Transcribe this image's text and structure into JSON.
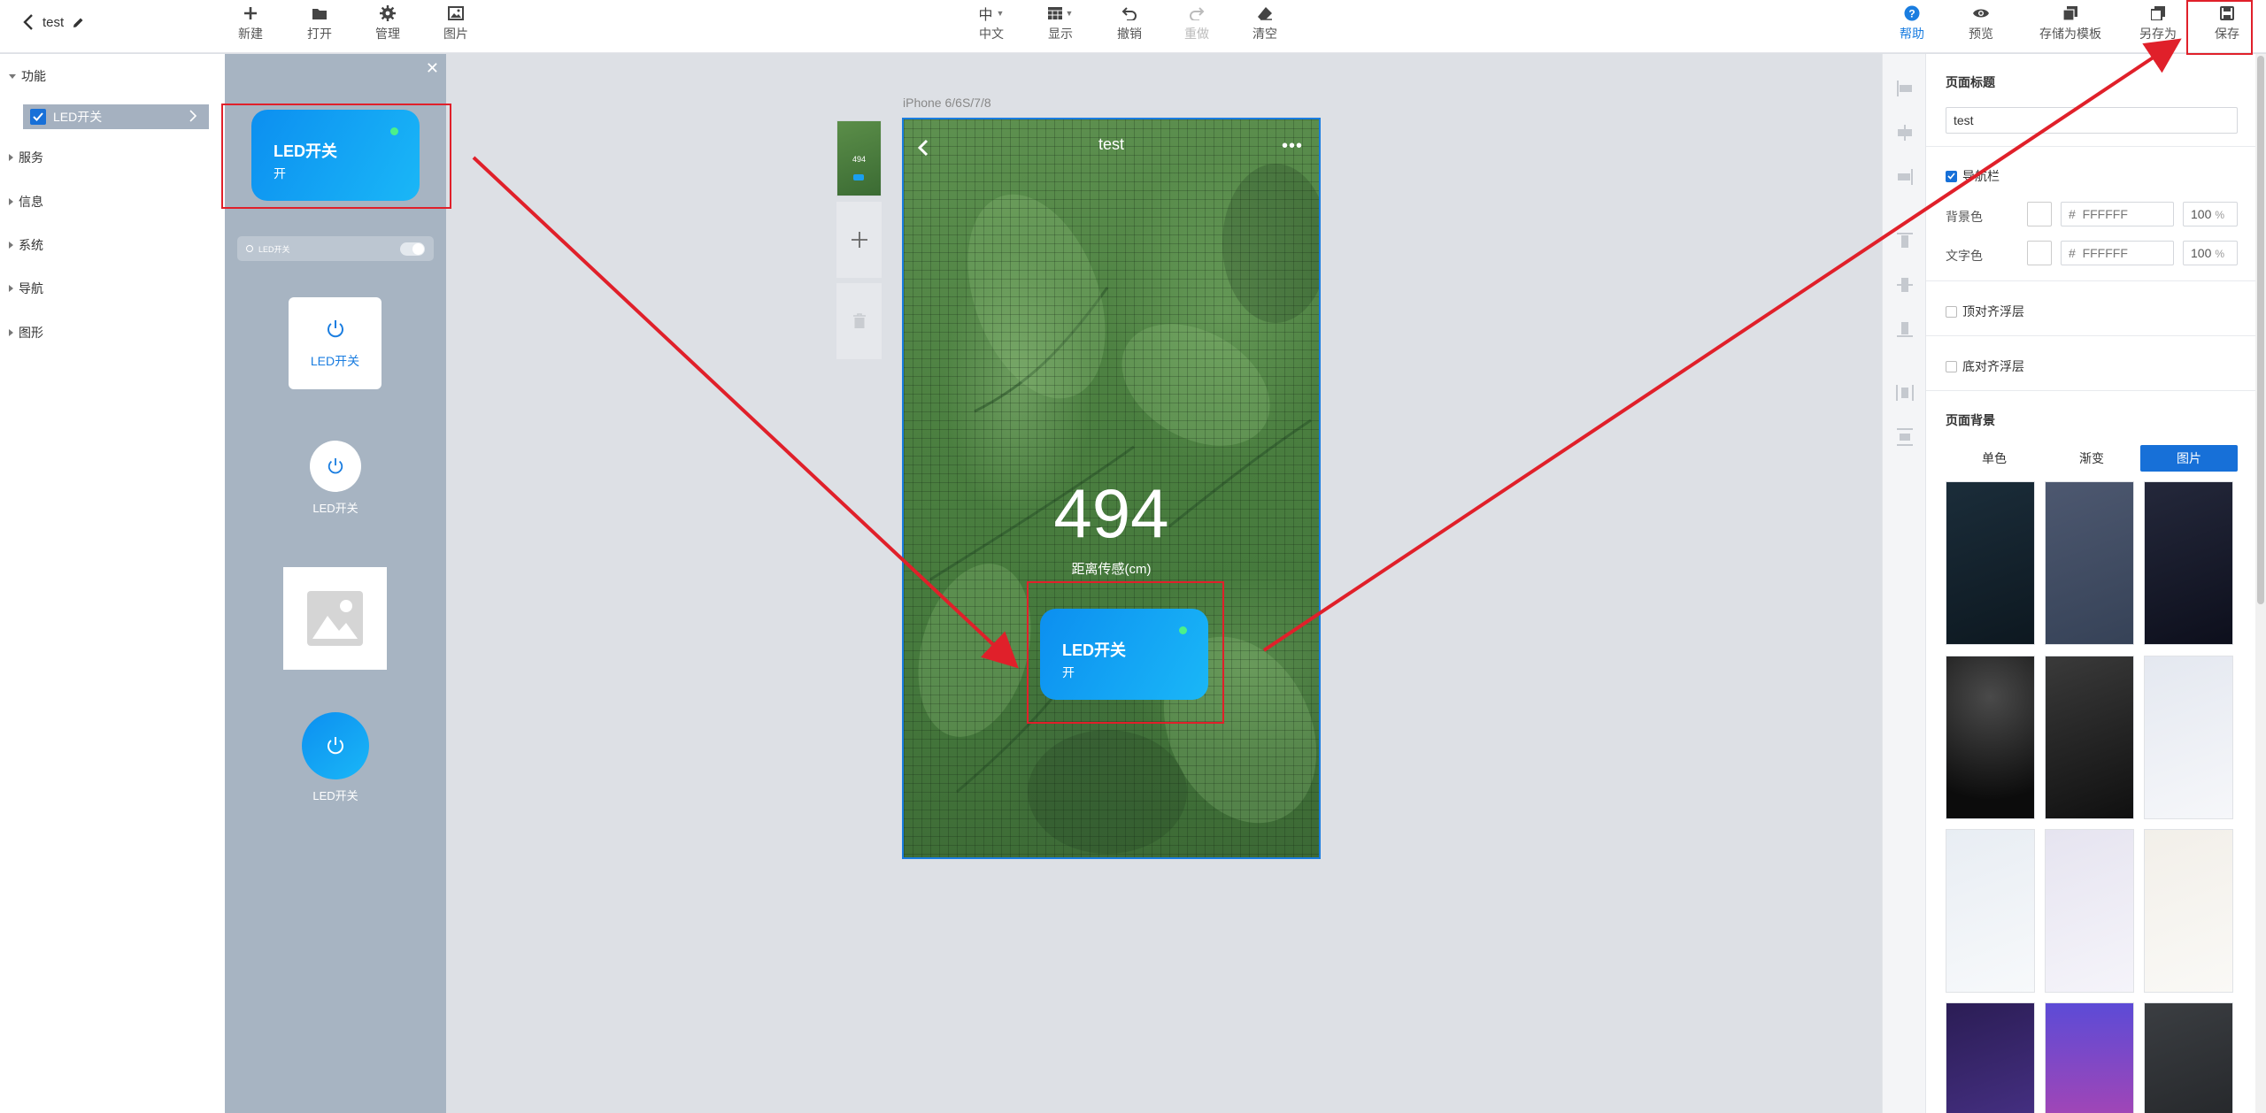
{
  "app": {
    "project_title": "test"
  },
  "toolbar": {
    "new": "新建",
    "open": "打开",
    "manage": "管理",
    "image": "图片",
    "language_icon_text": "中",
    "language": "中文",
    "display": "显示",
    "undo": "撤销",
    "redo": "重做",
    "clear": "清空",
    "help": "帮助",
    "preview": "预览",
    "save_as_template": "存储为模板",
    "save_as": "另存为",
    "save": "保存"
  },
  "tree": {
    "categories": [
      "功能",
      "服务",
      "信息",
      "系统",
      "导航",
      "图形"
    ],
    "selected_item": "LED开关"
  },
  "palette": {
    "card_title": "LED开关",
    "card_state": "开",
    "toggle_label": "LED开关",
    "square_label": "LED开关",
    "circle_label": "LED开关",
    "blue_circle_label": "LED开关"
  },
  "canvas": {
    "device": "iPhone 6/6S/7/8",
    "page_title": "test",
    "sensor_value": "494",
    "sensor_label": "距离传感(cm)",
    "thumb_value": "494",
    "led_card_title": "LED开关",
    "led_card_state": "开"
  },
  "properties": {
    "page_title_heading": "页面标题",
    "page_title_value": "test",
    "navbar_label": "导航栏",
    "bg_color_label": "背景色",
    "bg_color_hex": "FFFFFF",
    "bg_color_alpha": "100",
    "text_color_label": "文字色",
    "text_color_hex": "FFFFFF",
    "text_color_alpha": "100",
    "hash": "#",
    "pct_unit": "%",
    "top_align_label": "顶对齐浮层",
    "bottom_align_label": "底对齐浮层",
    "page_bg_heading": "页面背景",
    "bg_tabs": [
      "单色",
      "渐变",
      "图片"
    ],
    "bg_tab_active": "图片"
  },
  "colors": {
    "accent": "#1770d8",
    "card_gradient_start": "#0c8ff0",
    "card_gradient_end": "#1ab7f7",
    "led_dot": "#4cf08a",
    "annotation": "#e0202a"
  }
}
